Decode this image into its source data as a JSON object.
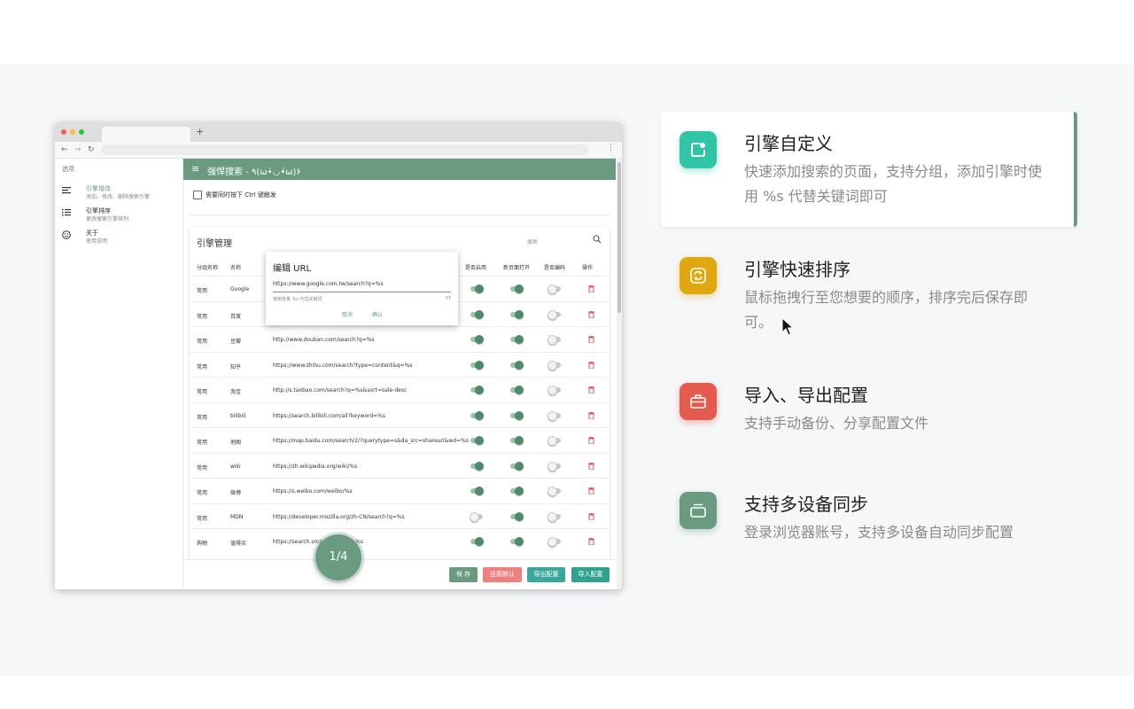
{
  "pager": "1/4",
  "colors": {
    "accent": "#6a9b80",
    "band_bg": "#f6f7f9",
    "red": "#e45a4f",
    "teal": "#2fc5a6",
    "amber": "#e0a710",
    "restore": "#f08080",
    "export": "#3aa99b",
    "import": "#2fa38f"
  },
  "browser": {
    "sidebar": {
      "title": "选项",
      "items": [
        {
          "label": "引擎增改",
          "sub": "添加、修改、删除搜索引擎",
          "icon": "list-edit-icon"
        },
        {
          "label": "引擎排序",
          "sub": "更改搜索引擎排列",
          "icon": "list-order-icon"
        },
        {
          "label": "关于",
          "sub": "使用说明",
          "icon": "smiley-icon"
        }
      ]
    },
    "appbar": {
      "title": "强悍搜索 - ٩(ω•̀◡•́ω)۶"
    },
    "ctrl_option": "需要同时按下 Ctrl 键触发",
    "card": {
      "title": "引擎管理",
      "search_label": "搜索",
      "headers": [
        "分组名称",
        "名称",
        "是否启用",
        "新页面打开",
        "是否编码",
        "操作"
      ],
      "rows": [
        {
          "group": "常用",
          "name": "Google",
          "url": "https://www.google.com.tw/search?q=%s",
          "enabled": true,
          "new_page": true,
          "encode": false
        },
        {
          "group": "常用",
          "name": "百度",
          "url": "https://www.baidu.com/s?wd=%s",
          "enabled": true,
          "new_page": true,
          "encode": false
        },
        {
          "group": "常用",
          "name": "豆瓣",
          "url": "http://www.douban.com/search?q=%s",
          "enabled": true,
          "new_page": true,
          "encode": false
        },
        {
          "group": "常用",
          "name": "知乎",
          "url": "https://www.zhihu.com/search?type=content&q=%s",
          "enabled": true,
          "new_page": true,
          "encode": false
        },
        {
          "group": "常用",
          "name": "淘宝",
          "url": "http://s.taobao.com/search?q=%s&sort=sale-desc",
          "enabled": true,
          "new_page": true,
          "encode": false
        },
        {
          "group": "常用",
          "name": "bilibili",
          "url": "https://search.bilibili.com/all?keyword=%s",
          "enabled": true,
          "new_page": true,
          "encode": false
        },
        {
          "group": "常用",
          "name": "地图",
          "url": "https://map.baidu.com/search/2/?querytype=s&da_src=shareurl&wd=%s",
          "enabled": true,
          "new_page": true,
          "encode": false
        },
        {
          "group": "常用",
          "name": "wiki",
          "url": "https://zh.wikipedia.org/wiki/%s",
          "enabled": true,
          "new_page": true,
          "encode": false
        },
        {
          "group": "常用",
          "name": "微博",
          "url": "https://s.weibo.com/weibo/%s",
          "enabled": true,
          "new_page": true,
          "encode": false
        },
        {
          "group": "常用",
          "name": "MDN",
          "url": "https://developer.mozilla.org/zh-CN/search?q=%s",
          "enabled": false,
          "new_page": true,
          "encode": false
        },
        {
          "group": "购物",
          "name": "值得买",
          "url": "https://search.smzdm.com/?s=%s",
          "enabled": true,
          "new_page": true,
          "encode": false
        }
      ]
    },
    "popup": {
      "title": "编辑 URL",
      "value": "https://www.google.com.tw/search?q=%s",
      "hint": "使用变量 %s 代替关键词",
      "count": "37",
      "cancel": "取消",
      "ok": "确认"
    },
    "buttons": {
      "save": "保 存",
      "restore": "还原默认",
      "export": "导出配置",
      "import": "导入配置"
    }
  },
  "features": [
    {
      "title": "引擎自定义",
      "desc": "快速添加搜索的页面，支持分组，添加引擎时使用 %s 代替关键词即可",
      "icon": "custom-engine-icon",
      "color": "#2fc5a6"
    },
    {
      "title": "引擎快速排序",
      "desc": "鼠标拖拽行至您想要的顺序，排序完后保存即可。",
      "icon": "sort-refresh-icon",
      "color": "#e0a710"
    },
    {
      "title": "导入、导出配置",
      "desc": "支持手动备份、分享配置文件",
      "icon": "briefcase-icon",
      "color": "#e45a4f"
    },
    {
      "title": "支持多设备同步",
      "desc": "登录浏览器账号，支持多设备自动同步配置",
      "icon": "sync-devices-icon",
      "color": "#6a9b80"
    }
  ]
}
